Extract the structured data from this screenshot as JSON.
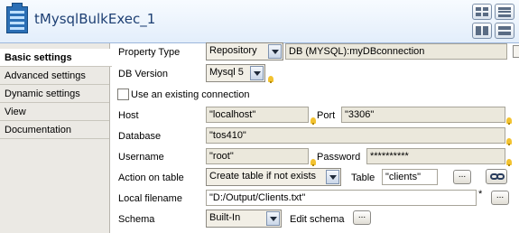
{
  "header": {
    "title": "tMysqlBulkExec_1"
  },
  "tabs": [
    {
      "label": "Basic settings",
      "active": true
    },
    {
      "label": "Advanced settings"
    },
    {
      "label": "Dynamic settings"
    },
    {
      "label": "View"
    },
    {
      "label": "Documentation"
    }
  ],
  "form": {
    "property_type": {
      "label": "Property Type",
      "value": "Repository",
      "repository": "DB (MYSQL):myDBconnection"
    },
    "db_version": {
      "label": "DB Version",
      "value": "Mysql 5"
    },
    "existing_connection": {
      "label": "Use an existing connection",
      "checked": false
    },
    "host": {
      "label": "Host",
      "value": "\"localhost\""
    },
    "port": {
      "label": "Port",
      "value": "\"3306\""
    },
    "database": {
      "label": "Database",
      "value": "\"tos410\""
    },
    "username": {
      "label": "Username",
      "value": "\"root\""
    },
    "password": {
      "label": "Password",
      "value": "**********"
    },
    "action_on_table": {
      "label": "Action on table",
      "value": "Create table if not exists"
    },
    "table": {
      "label": "Table",
      "value": "\"clients\""
    },
    "local_filename": {
      "label": "Local filename",
      "value": "\"D:/Output/Clients.txt\"",
      "required_mark": "*"
    },
    "schema": {
      "label": "Schema",
      "value": "Built-In",
      "edit_label": "Edit schema"
    },
    "dots": "..."
  }
}
